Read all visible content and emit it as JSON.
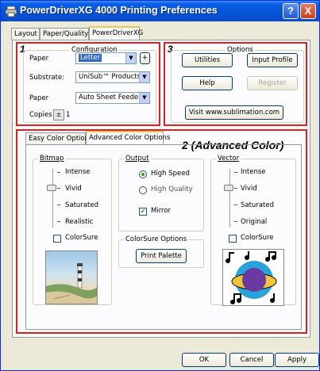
{
  "window": {
    "title": "PowerDriverXG 4000 Printing Preferences",
    "help": "?",
    "close": "X"
  },
  "tabs": [
    "Layout",
    "Paper/Quality",
    "PowerDriverXG"
  ],
  "annotations": {
    "box1": "1",
    "box3": "3",
    "box2": "2 (Advanced Color)"
  },
  "configuration": {
    "legend": "Configuration",
    "paper_label": "Paper",
    "paper_value": "Letter",
    "paper_add": "+",
    "substrate_label": "Substrate:",
    "substrate_value": "UniSub™ Products",
    "paper2_label": "Paper",
    "paper2_value": "Auto Sheet Feeder",
    "copies_label": "Copies",
    "copies_value": "1"
  },
  "options": {
    "legend": "Options",
    "utilities": "Utilities",
    "input_profile": "Input Profile",
    "help": "Help",
    "register": "Register",
    "visit": "Visit www.sublimation.com"
  },
  "color_tabs": [
    "Easy Color Options",
    "Advanced Color Options"
  ],
  "bitmap": {
    "legend": "Bitmap",
    "levels": [
      "Intense",
      "Vivid",
      "Saturated",
      "Realistic"
    ],
    "selected_level": "Vivid",
    "colorsure_label": "ColorSure",
    "colorsure_checked": false
  },
  "output": {
    "legend": "Output",
    "high_speed": "High Speed",
    "high_quality": "High Quality",
    "selected": "High Speed",
    "mirror": "Mirror",
    "mirror_checked": true
  },
  "colorsure_options": {
    "legend": "ColorSure Options",
    "print_palette": "Print Palette"
  },
  "vector": {
    "legend": "Vector",
    "levels": [
      "Intense",
      "Vivid",
      "Saturated",
      "Original"
    ],
    "selected_level": "Vivid",
    "colorsure_label": "ColorSure",
    "colorsure_checked": false
  },
  "footer": {
    "ok": "OK",
    "cancel": "Cancel",
    "apply": "Apply"
  },
  "colors": {
    "title_bar": "#0553d6",
    "highlight_red": "#e02020",
    "selection": "#316ac5",
    "dialog_bg": "#ece9d8"
  }
}
